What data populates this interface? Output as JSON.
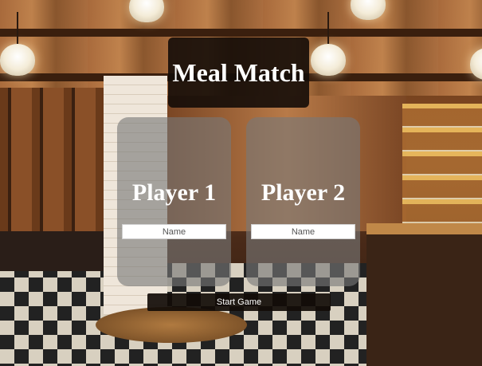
{
  "app": {
    "title": "Meal Match"
  },
  "players": [
    {
      "label": "Player 1",
      "input_placeholder": "Name",
      "input_value": ""
    },
    {
      "label": "Player 2",
      "input_placeholder": "Name",
      "input_value": ""
    }
  ],
  "actions": {
    "start_label": "Start Game"
  },
  "colors": {
    "panel": "#14100c",
    "card": "#787878",
    "text": "#ffffff"
  }
}
